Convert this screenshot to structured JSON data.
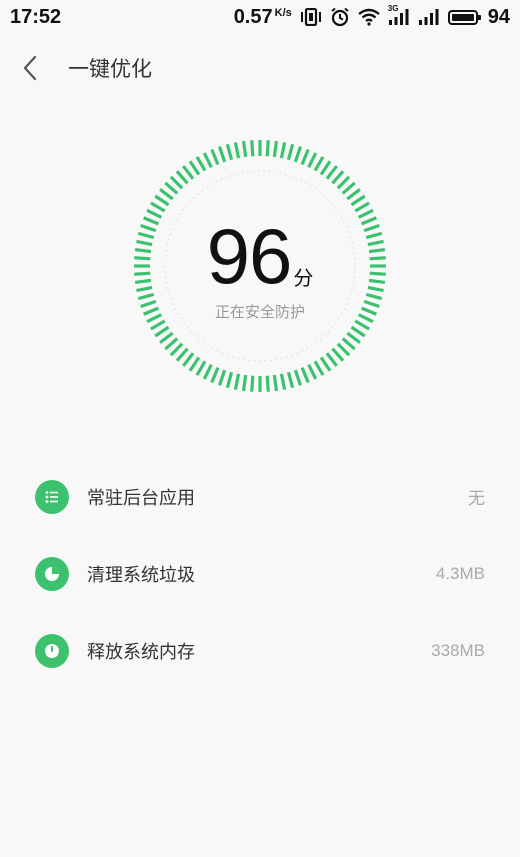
{
  "status_bar": {
    "time": "17:52",
    "net_speed": "0.57",
    "net_speed_unit": "K/s",
    "network_type": "3G",
    "battery": "94"
  },
  "header": {
    "title": "一键优化",
    "back_icon": "chevron-left-icon"
  },
  "score": {
    "value": "96",
    "unit": "分",
    "status": "正在安全防护",
    "ring_color": "#3cc26f"
  },
  "items": [
    {
      "label": "常驻后台应用",
      "value": "无",
      "icon": "list-icon"
    },
    {
      "label": "清理系统垃圾",
      "value": "4.3MB",
      "icon": "pie-chart-icon"
    },
    {
      "label": "释放系统内存",
      "value": "338MB",
      "icon": "clock-icon"
    }
  ],
  "colors": {
    "accent": "#3cc26f",
    "background": "#f8f8f8"
  }
}
